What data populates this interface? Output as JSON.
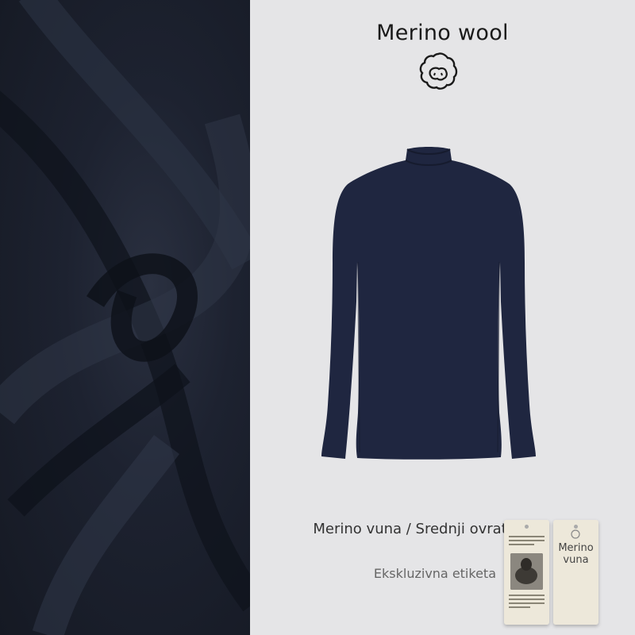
{
  "headline": "Merino wool",
  "product": {
    "name_line": "Merino vuna / Srednji ovratnik",
    "label_note": "Ekskluzivna etiketa"
  },
  "hang_tag": {
    "label": "Merino vuna"
  },
  "icons": [
    "sheep-icon",
    "turtleneck-shirt-image",
    "fabric-swirl-image",
    "hang-tag-image"
  ],
  "colors": {
    "shirt": "#1f2640",
    "fabric": "#1b2030",
    "background": "#e5e5e7",
    "tag": "#ede8da"
  }
}
